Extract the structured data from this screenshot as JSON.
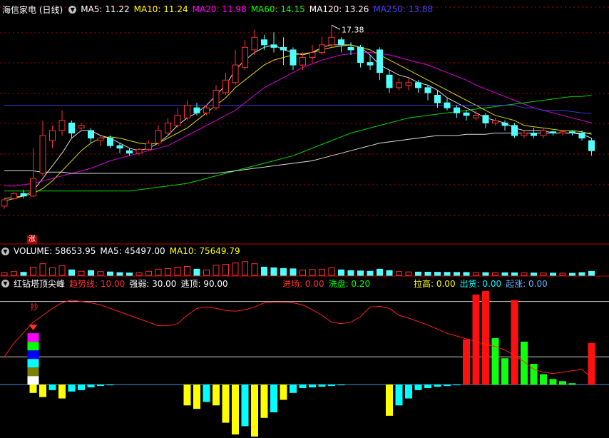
{
  "main": {
    "title": "海信家电 (日线)",
    "mas": [
      {
        "label": "MA5: 11.22",
        "color": "#ffffff"
      },
      {
        "label": "MA10: 11.24",
        "color": "#ffff00"
      },
      {
        "label": "MA20: 11.98",
        "color": "#ff00ff"
      },
      {
        "label": "MA60: 14.15",
        "color": "#00ff00"
      },
      {
        "label": "MA120: 13.26",
        "color": "#ffffff"
      },
      {
        "label": "MA250: 13.88",
        "color": "#4040ff"
      }
    ],
    "high_label": "17.38",
    "limit_badge": "涨"
  },
  "volume": {
    "labels": [
      {
        "label": "VOLUME: 58653.95",
        "color": "#ffffff"
      },
      {
        "label": "MA5: 45497.00",
        "color": "#ffffff"
      },
      {
        "label": "MA10: 75649.79",
        "color": "#ffff00"
      }
    ]
  },
  "indicator": {
    "name": "红钻塔顶尖峰",
    "params": [
      {
        "label": "趋势线: 10.00",
        "color": "#ff3030"
      },
      {
        "label": "强弱: 30.00",
        "color": "#ffffff"
      },
      {
        "label": "逃顶: 90.00",
        "color": "#ffffff"
      }
    ],
    "params2": [
      {
        "label": "进场: 0.00",
        "color": "#ff3030"
      },
      {
        "label": "洗盘: 0.20",
        "color": "#00ff00"
      }
    ],
    "params3": [
      {
        "label": "拉高: 0.00",
        "color": "#ffff00"
      },
      {
        "label": "出货: 0.00",
        "color": "#00ffff"
      },
      {
        "label": "起涨: 0.00",
        "color": "#6ab0ff"
      }
    ],
    "sell_mark": "抄"
  },
  "colors": {
    "up": "#ff3030",
    "down": "#50ffff",
    "grid": "#b00000"
  },
  "chart_data": {
    "type": "candlestick",
    "price_range": [
      10.0,
      17.7
    ],
    "candles": [
      [
        10.2,
        10.45,
        10.1,
        10.5
      ],
      [
        10.5,
        10.7,
        10.45,
        10.75
      ],
      [
        10.7,
        10.6,
        10.5,
        10.85
      ],
      [
        10.6,
        11.3,
        10.55,
        12.5
      ],
      [
        11.5,
        13.0,
        11.4,
        13.6
      ],
      [
        12.8,
        13.2,
        12.5,
        13.4
      ],
      [
        13.2,
        13.6,
        13.0,
        14.0
      ],
      [
        13.5,
        13.1,
        12.9,
        13.6
      ],
      [
        13.3,
        13.4,
        13.2,
        13.5
      ],
      [
        13.2,
        12.9,
        12.7,
        13.3
      ],
      [
        12.8,
        12.9,
        12.6,
        13.0
      ],
      [
        12.9,
        12.6,
        12.5,
        13.0
      ],
      [
        12.6,
        12.5,
        12.3,
        12.7
      ],
      [
        12.4,
        12.3,
        12.2,
        12.5
      ],
      [
        12.3,
        12.45,
        12.2,
        12.5
      ],
      [
        12.45,
        12.7,
        12.4,
        12.8
      ],
      [
        12.7,
        13.2,
        12.6,
        13.4
      ],
      [
        13.1,
        13.5,
        13.0,
        13.7
      ],
      [
        13.4,
        13.8,
        13.3,
        14.1
      ],
      [
        13.7,
        14.2,
        13.6,
        14.4
      ],
      [
        14.1,
        13.9,
        13.8,
        14.3
      ],
      [
        13.9,
        14.1,
        13.8,
        14.2
      ],
      [
        14.1,
        14.8,
        14.0,
        15.0
      ],
      [
        14.7,
        15.2,
        14.6,
        15.5
      ],
      [
        15.1,
        15.8,
        15.0,
        16.4
      ],
      [
        15.7,
        16.5,
        15.6,
        16.8
      ],
      [
        16.4,
        16.9,
        16.2,
        17.2
      ],
      [
        16.8,
        16.6,
        16.4,
        17.0
      ],
      [
        16.6,
        16.5,
        16.3,
        17.1
      ],
      [
        16.5,
        16.4,
        15.8,
        16.9
      ],
      [
        16.4,
        15.8,
        15.6,
        16.5
      ],
      [
        15.8,
        16.1,
        15.6,
        16.3
      ],
      [
        16.1,
        16.3,
        15.9,
        16.6
      ],
      [
        16.3,
        16.6,
        16.2,
        16.9
      ],
      [
        16.6,
        16.9,
        16.5,
        17.38
      ],
      [
        16.8,
        16.6,
        16.3,
        16.9
      ],
      [
        16.5,
        16.4,
        16.2,
        16.7
      ],
      [
        16.5,
        15.9,
        15.7,
        16.6
      ],
      [
        15.9,
        15.8,
        15.6,
        16.2
      ],
      [
        16.4,
        15.5,
        15.2,
        16.5
      ],
      [
        15.4,
        14.9,
        14.7,
        15.6
      ],
      [
        14.9,
        15.1,
        14.8,
        15.3
      ],
      [
        15.0,
        15.1,
        14.8,
        15.3
      ],
      [
        15.1,
        14.9,
        14.7,
        15.2
      ],
      [
        14.9,
        14.7,
        14.4,
        15.0
      ],
      [
        14.6,
        14.3,
        14.1,
        14.8
      ],
      [
        14.3,
        14.1,
        14.0,
        14.5
      ],
      [
        14.1,
        13.9,
        13.7,
        14.2
      ],
      [
        13.9,
        13.8,
        13.6,
        14.0
      ],
      [
        13.7,
        13.8,
        13.6,
        14.0
      ],
      [
        13.8,
        13.5,
        13.3,
        13.9
      ],
      [
        13.5,
        13.6,
        13.4,
        13.7
      ],
      [
        13.5,
        13.4,
        13.2,
        13.6
      ],
      [
        13.4,
        13.0,
        12.9,
        13.5
      ],
      [
        13.0,
        13.1,
        12.9,
        13.2
      ],
      [
        13.1,
        13.0,
        12.9,
        13.3
      ],
      [
        13.0,
        13.2,
        12.9,
        13.3
      ],
      [
        13.15,
        13.1,
        13.0,
        13.2
      ],
      [
        13.1,
        13.15,
        13.0,
        13.2
      ],
      [
        13.15,
        13.1,
        13.0,
        13.2
      ],
      [
        13.1,
        12.9,
        12.8,
        13.2
      ],
      [
        12.8,
        12.4,
        12.2,
        12.9
      ]
    ],
    "ma_lines": [
      {
        "name": "MA5",
        "color": "#ffffff",
        "values": [
          10.4,
          10.5,
          10.6,
          10.8,
          11.3,
          11.8,
          12.3,
          12.9,
          13.2,
          13.2,
          13.0,
          12.9,
          12.7,
          12.5,
          12.4,
          12.5,
          12.7,
          13.0,
          13.4,
          13.7,
          13.9,
          14.2,
          14.6,
          15.0,
          15.6,
          16.0,
          16.3,
          16.5,
          16.6,
          16.4,
          16.3,
          16.2,
          16.3,
          16.5,
          16.6,
          16.6,
          16.6,
          16.5,
          16.2,
          15.8,
          15.6,
          15.4,
          15.3,
          15.1,
          15.0,
          14.8,
          14.5,
          14.3,
          14.1,
          13.9,
          13.7,
          13.6,
          13.5,
          13.3,
          13.2,
          13.2,
          13.2,
          13.1,
          13.1,
          13.1,
          13.05,
          12.9
        ]
      },
      {
        "name": "MA10",
        "color": "#ffff00",
        "values": [
          10.5,
          10.55,
          10.6,
          10.7,
          10.9,
          11.2,
          11.6,
          12.0,
          12.4,
          12.7,
          12.9,
          12.95,
          12.9,
          12.8,
          12.7,
          12.65,
          12.7,
          12.9,
          13.1,
          13.3,
          13.6,
          13.9,
          14.2,
          14.5,
          14.9,
          15.2,
          15.5,
          15.8,
          16.0,
          16.1,
          16.2,
          16.25,
          16.3,
          16.4,
          16.5,
          16.55,
          16.6,
          16.5,
          16.4,
          16.2,
          16.0,
          15.8,
          15.6,
          15.4,
          15.2,
          15.0,
          14.8,
          14.6,
          14.4,
          14.2,
          14.0,
          13.8,
          13.7,
          13.6,
          13.4,
          13.35,
          13.3,
          13.25,
          13.2,
          13.2,
          13.15,
          13.05
        ]
      },
      {
        "name": "MA20",
        "color": "#ff00ff",
        "values": [
          11.0,
          11.0,
          11.05,
          11.1,
          11.2,
          11.3,
          11.4,
          11.5,
          11.6,
          11.7,
          11.85,
          12.0,
          12.1,
          12.2,
          12.3,
          12.4,
          12.5,
          12.6,
          12.8,
          13.0,
          13.2,
          13.4,
          13.6,
          13.8,
          14.0,
          14.3,
          14.6,
          14.9,
          15.1,
          15.3,
          15.5,
          15.7,
          15.85,
          16.0,
          16.1,
          16.2,
          16.25,
          16.3,
          16.3,
          16.25,
          16.2,
          16.1,
          16.0,
          15.9,
          15.8,
          15.65,
          15.5,
          15.35,
          15.2,
          15.0,
          14.85,
          14.7,
          14.55,
          14.4,
          14.25,
          14.1,
          14.0,
          13.9,
          13.8,
          13.7,
          13.6,
          13.5
        ]
      },
      {
        "name": "MA60",
        "color": "#00ff00",
        "values": [
          10.8,
          10.8,
          10.8,
          10.8,
          10.8,
          10.8,
          10.8,
          10.8,
          10.8,
          10.8,
          10.8,
          10.8,
          10.8,
          10.8,
          10.85,
          10.9,
          10.95,
          11.0,
          11.05,
          11.1,
          11.2,
          11.3,
          11.4,
          11.5,
          11.6,
          11.7,
          11.8,
          11.9,
          12.0,
          12.1,
          12.2,
          12.35,
          12.5,
          12.65,
          12.8,
          12.95,
          13.1,
          13.2,
          13.3,
          13.4,
          13.5,
          13.6,
          13.7,
          13.75,
          13.8,
          13.85,
          13.9,
          13.95,
          14.0,
          14.05,
          14.1,
          14.15,
          14.2,
          14.25,
          14.3,
          14.35,
          14.4,
          14.45,
          14.5,
          14.55,
          14.55,
          14.6
        ]
      },
      {
        "name": "MA120",
        "color": "#ffffff",
        "values": [
          11.6,
          11.6,
          11.6,
          11.6,
          11.55,
          11.55,
          11.55,
          11.5,
          11.5,
          11.5,
          11.5,
          11.5,
          11.5,
          11.5,
          11.5,
          11.5,
          11.5,
          11.5,
          11.5,
          11.5,
          11.5,
          11.5,
          11.5,
          11.55,
          11.6,
          11.65,
          11.7,
          11.75,
          11.8,
          11.85,
          11.9,
          11.95,
          12.0,
          12.1,
          12.2,
          12.3,
          12.4,
          12.5,
          12.6,
          12.7,
          12.75,
          12.8,
          12.85,
          12.9,
          12.95,
          13.0,
          13.0,
          13.0,
          13.05,
          13.05,
          13.05,
          13.1,
          13.1,
          13.1,
          13.1,
          13.1,
          13.1,
          13.1,
          13.1,
          13.1,
          13.1,
          13.1
        ]
      },
      {
        "name": "MA250",
        "color": "#4040ff",
        "values": [
          14.2,
          14.2,
          14.2,
          14.2,
          14.2,
          14.2,
          14.2,
          14.2,
          14.2,
          14.2,
          14.2,
          14.2,
          14.2,
          14.2,
          14.2,
          14.2,
          14.2,
          14.2,
          14.2,
          14.2,
          14.2,
          14.2,
          14.2,
          14.2,
          14.2,
          14.2,
          14.2,
          14.2,
          14.2,
          14.2,
          14.2,
          14.2,
          14.2,
          14.2,
          14.2,
          14.2,
          14.2,
          14.2,
          14.2,
          14.2,
          14.2,
          14.2,
          14.2,
          14.2,
          14.2,
          14.2,
          14.2,
          14.2,
          14.2,
          14.2,
          14.2,
          14.2,
          14.2,
          14.2,
          14.1,
          14.1,
          14.0,
          14.0,
          14.0,
          13.95,
          13.9,
          13.88
        ]
      }
    ],
    "volume_range": [
      0,
      250000
    ],
    "volume": [
      40000,
      55000,
      45000,
      120000,
      170000,
      110000,
      140000,
      80000,
      60000,
      70000,
      55000,
      50000,
      40000,
      35000,
      42000,
      60000,
      90000,
      100000,
      120000,
      130000,
      90000,
      80000,
      150000,
      160000,
      180000,
      200000,
      170000,
      120000,
      110000,
      100000,
      95000,
      80000,
      85000,
      90000,
      110000,
      80000,
      70000,
      65000,
      60000,
      90000,
      70000,
      55000,
      50000,
      48000,
      47000,
      45000,
      44000,
      43000,
      42000,
      41000,
      40000,
      39000,
      38000,
      37000,
      36000,
      35000,
      34000,
      33000,
      32000,
      31000,
      40000,
      58653.95
    ],
    "indicator_range": [
      -75,
      135
    ],
    "indicator_levels": [
      0,
      40,
      120
    ],
    "trend_line": [
      40,
      60,
      75,
      90,
      100,
      110,
      118,
      122,
      120,
      118,
      115,
      110,
      105,
      100,
      95,
      90,
      85,
      85,
      88,
      100,
      110,
      112,
      110,
      107,
      106,
      108,
      112,
      118,
      119,
      119,
      118,
      115,
      108,
      100,
      90,
      88,
      90,
      98,
      112,
      113,
      110,
      100,
      96,
      91,
      86,
      80,
      74,
      70,
      66,
      62,
      58,
      55,
      50,
      42,
      33,
      22,
      18,
      16,
      18,
      20,
      22,
      10
    ],
    "indicator_bars": [
      0,
      0,
      0,
      -12,
      -18,
      -8,
      -20,
      -10,
      -8,
      -4,
      -2,
      -1,
      0,
      0,
      0,
      0,
      0,
      0,
      0,
      -30,
      -35,
      -25,
      -30,
      -55,
      -72,
      -60,
      -75,
      -48,
      -40,
      -22,
      -12,
      -5,
      -4,
      -3,
      -2,
      -1,
      0,
      0,
      0,
      0,
      -45,
      -30,
      -20,
      -8,
      -5,
      -3,
      -2,
      -1,
      0,
      0,
      0,
      0,
      0,
      0,
      0,
      0,
      0,
      0,
      0,
      0,
      0,
      0
    ],
    "indicator_bar_colors": [
      "c",
      "c",
      "c",
      "y",
      "y",
      "c",
      "y",
      "c",
      "c",
      "c",
      "c",
      "c",
      "c",
      "c",
      "c",
      "c",
      "c",
      "c",
      "c",
      "y",
      "y",
      "c",
      "y",
      "y",
      "y",
      "c",
      "y",
      "y",
      "c",
      "y",
      "c",
      "c",
      "c",
      "c",
      "c",
      "c",
      "c",
      "c",
      "c",
      "c",
      "y",
      "c",
      "c",
      "c",
      "c",
      "c",
      "c",
      "c",
      "c",
      "c",
      "c",
      "c",
      "c",
      "c",
      "c",
      "c",
      "c",
      "c",
      "c",
      "c",
      "c",
      "c"
    ],
    "signal_bars": [
      {
        "i": 48,
        "v": 65,
        "c": "r"
      },
      {
        "i": 49,
        "v": 130,
        "c": "r"
      },
      {
        "i": 50,
        "v": 135,
        "c": "r"
      },
      {
        "i": 51,
        "v": 67,
        "c": "g"
      },
      {
        "i": 52,
        "v": 38,
        "c": "g"
      },
      {
        "i": 53,
        "v": 122,
        "c": "r"
      },
      {
        "i": 54,
        "v": 62,
        "c": "g"
      },
      {
        "i": 55,
        "v": 30,
        "c": "g"
      },
      {
        "i": 56,
        "v": 15,
        "c": "g"
      },
      {
        "i": 57,
        "v": 8,
        "c": "g"
      },
      {
        "i": 58,
        "v": 5,
        "c": "g"
      },
      {
        "i": 59,
        "v": 2,
        "c": "g"
      },
      {
        "i": 61,
        "v": 60,
        "c": "r"
      }
    ]
  }
}
